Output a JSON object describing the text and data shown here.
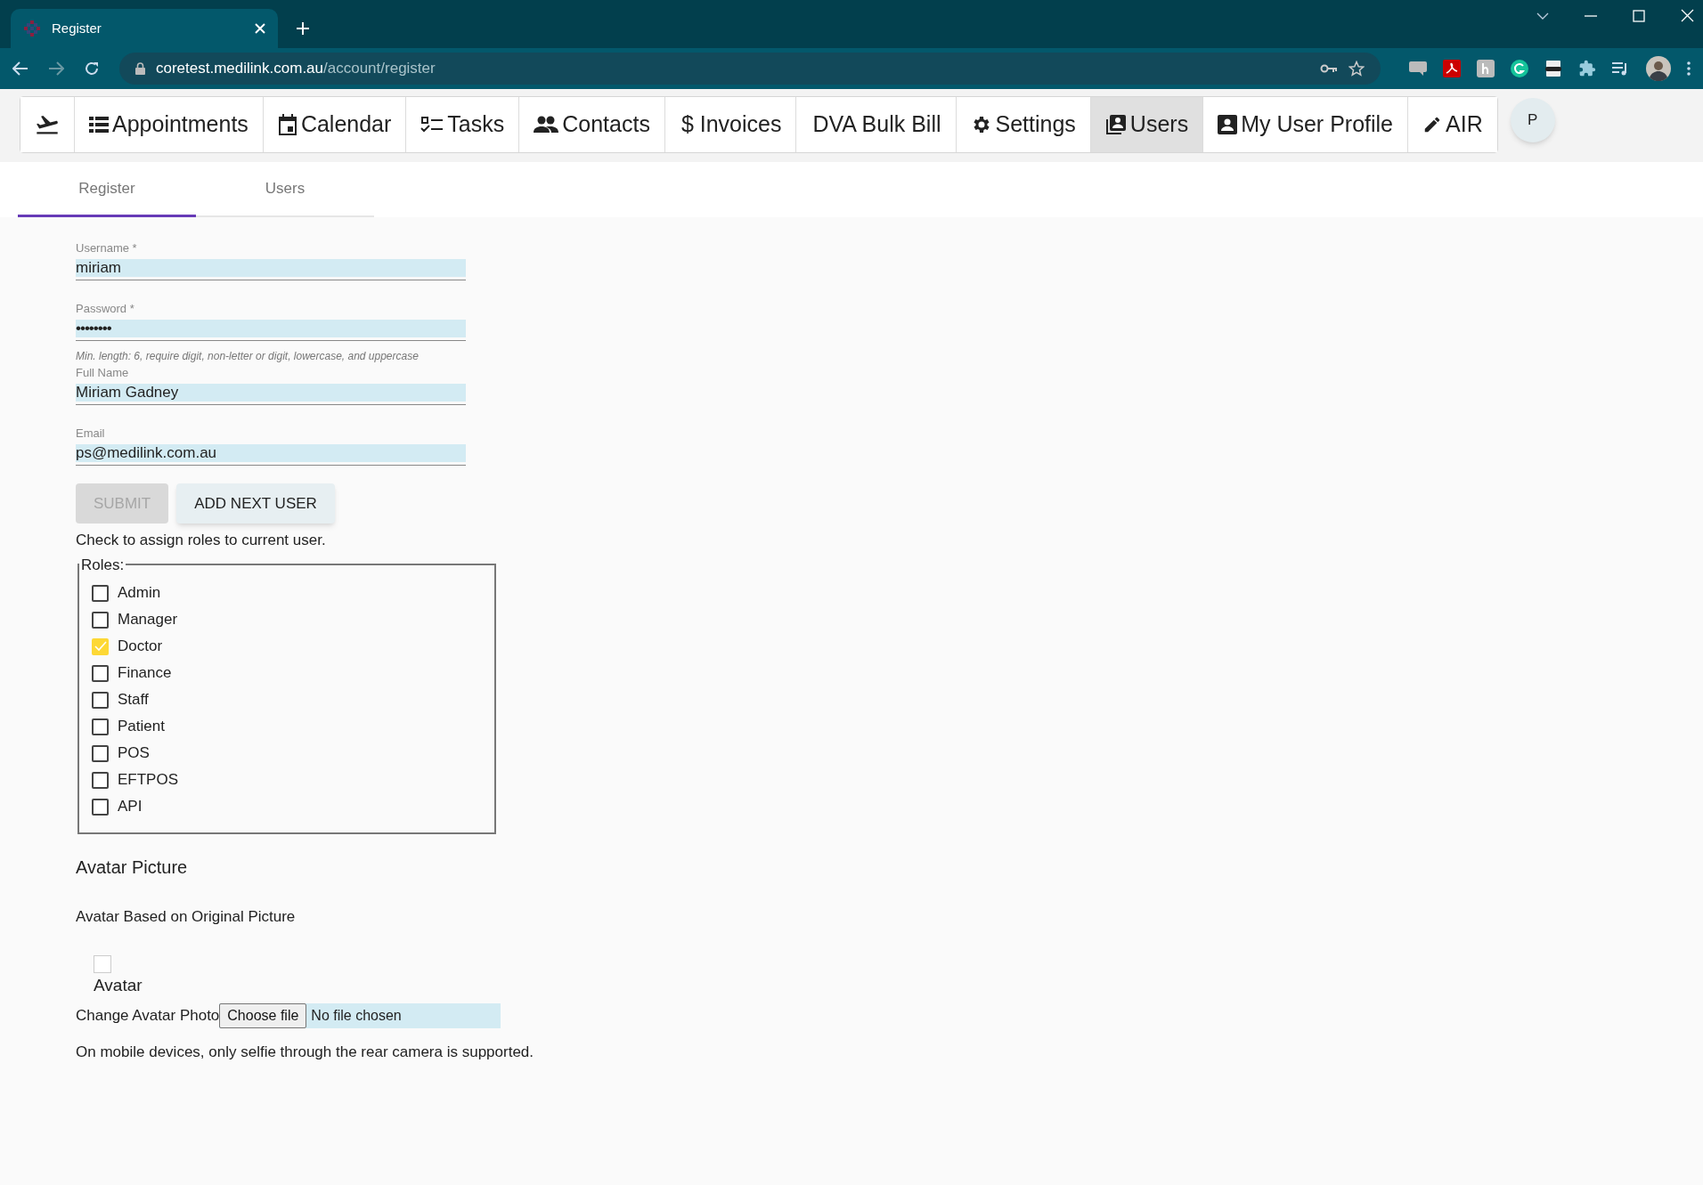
{
  "browser": {
    "tab_title": "Register",
    "url_host": "coretest.medilink.com.au",
    "url_path": "/account/register"
  },
  "nav": {
    "items": [
      {
        "selected": false
      },
      {
        "label": "Appointments",
        "selected": false
      },
      {
        "label": "Calendar",
        "selected": false
      },
      {
        "label": "Tasks",
        "selected": false
      },
      {
        "label": "Contacts",
        "selected": false
      },
      {
        "label": "$ Invoices",
        "selected": false
      },
      {
        "label": "DVA Bulk Bill",
        "selected": false
      },
      {
        "label": "Settings",
        "selected": false
      },
      {
        "label": "Users",
        "selected": true
      },
      {
        "label": "My User Profile",
        "selected": false
      },
      {
        "label": "AIR",
        "selected": false
      }
    ],
    "account_initial": "P"
  },
  "subtabs": [
    {
      "label": "Register",
      "selected": true
    },
    {
      "label": "Users",
      "selected": false
    }
  ],
  "fields": [
    {
      "label": "Username *",
      "value": "miriam",
      "kind": "text"
    },
    {
      "label": "Password *",
      "value": "••••••••",
      "kind": "password",
      "hint": "Min. length: 6, require digit, non-letter or digit, lowercase, and uppercase"
    },
    {
      "label": "Full Name",
      "value": "Miriam Gadney",
      "kind": "text"
    },
    {
      "label": "Email",
      "value": "ps@medilink.com.au",
      "kind": "text"
    }
  ],
  "buttons": [
    {
      "label": "SUBMIT",
      "disabled": true
    },
    {
      "label": "ADD NEXT USER",
      "disabled": false
    }
  ],
  "roles_instruction": "Check to assign roles to current user.",
  "roles": {
    "legend": "Roles:",
    "items": [
      {
        "label": "Admin",
        "checked": false
      },
      {
        "label": "Manager",
        "checked": false
      },
      {
        "label": "Doctor",
        "checked": true
      },
      {
        "label": "Finance",
        "checked": false
      },
      {
        "label": "Staff",
        "checked": false
      },
      {
        "label": "Patient",
        "checked": false
      },
      {
        "label": "POS",
        "checked": false
      },
      {
        "label": "EFTPOS",
        "checked": false
      },
      {
        "label": "API",
        "checked": false
      }
    ]
  },
  "avatar": {
    "heading": "Avatar Picture",
    "subheading": "Avatar Based on Original Picture",
    "image_alt": "Avatar",
    "change_label": "Change Avatar Photo",
    "choose_button": "Choose file",
    "file_status": "No file chosen",
    "note": "On mobile devices, only selfie through the rear camera is supported."
  }
}
